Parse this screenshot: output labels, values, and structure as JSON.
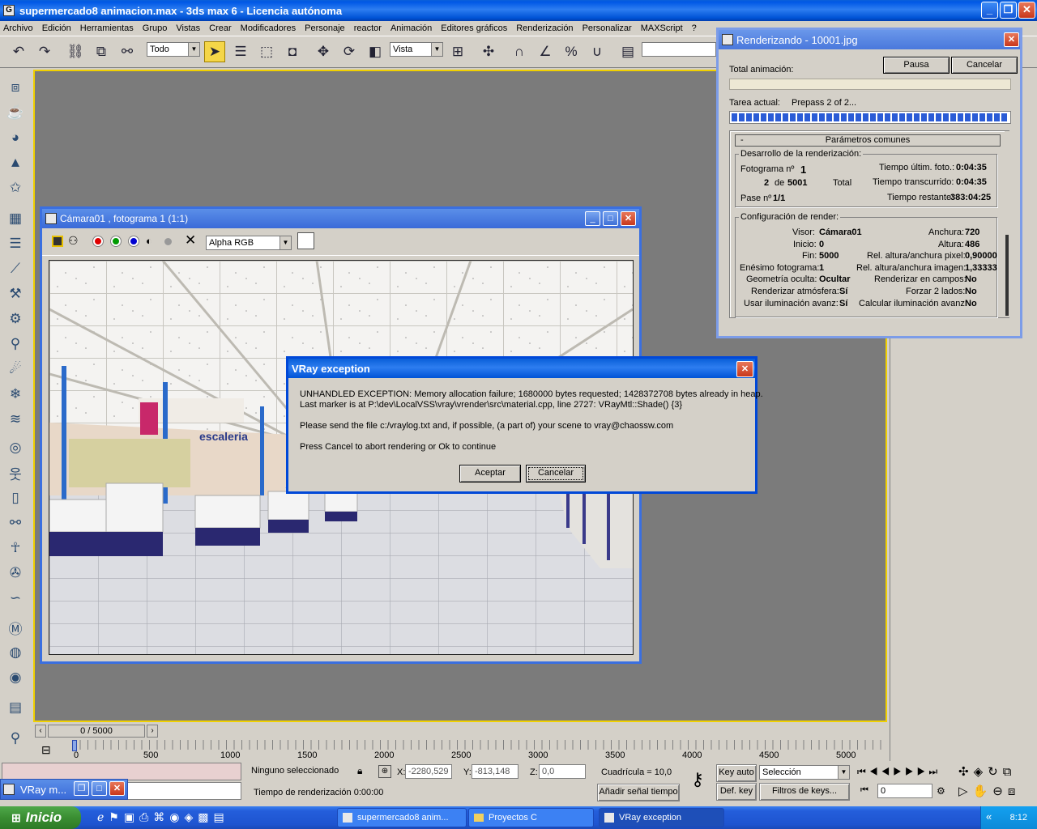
{
  "main_window": {
    "title": "supermercado8 animacion.max - 3ds max 6 - Licencia autónoma",
    "minimize": "_",
    "maximize": "❐",
    "close": "✕"
  },
  "menu": [
    "Archivo",
    "Edición",
    "Herramientas",
    "Grupo",
    "Vistas",
    "Crear",
    "Modificadores",
    "Personaje",
    "reactor",
    "Animación",
    "Editores gráficos",
    "Renderización",
    "Personalizar",
    "MAXScript",
    "?"
  ],
  "toolbar": {
    "selection_filter": "Todo",
    "coord_system": "Vista"
  },
  "frame_window": {
    "title": "Cámara01 , fotograma 1 (1:1)",
    "channel": "Alpha RGB",
    "sign_text": "escaleria",
    "colors": {
      "red": "#e00000",
      "green": "#009a00",
      "blue": "#0000d0"
    }
  },
  "render_dialog": {
    "title": "Renderizando - 10001.jpg",
    "pause": "Pausa",
    "cancel": "Cancelar",
    "total_label": "Total animación:",
    "task_label": "Tarea actual:",
    "task_value": "Prepass 2 of 2...",
    "task_progress": 1.0,
    "section_toggle": "-",
    "section_title": "Parámetros comunes",
    "progress_group": "Desarrollo de la renderización:",
    "frame_label": "Fotograma nº",
    "frame_value": "1",
    "frame_count_a": "2",
    "frame_count_de": "de",
    "frame_count_b": "5001",
    "total_word": "Total",
    "pass_label": "Pase nº",
    "pass_value": "1/1",
    "last_frame_label": "Tiempo últim. foto.:",
    "last_frame_value": "0:04:35",
    "elapsed_label": "Tiempo transcurrido:",
    "elapsed_value": "0:04:35",
    "remaining_label": "Tiempo restante:",
    "remaining_value": "383:04:25",
    "config_group": "Configuración de render:",
    "cfg": {
      "visor_l": "Visor:",
      "visor_v": "Cámara01",
      "inicio_l": "Inicio:",
      "inicio_v": "0",
      "fin_l": "Fin:",
      "fin_v": "5000",
      "nth_l": "Enésimo fotograma:",
      "nth_v": "1",
      "hidden_l": "Geometría oculta:",
      "hidden_v": "Ocultar",
      "atm_l": "Renderizar atmósfera:",
      "atm_v": "Sí",
      "adv_l": "Usar iluminación avanz:",
      "adv_v": "Sí",
      "width_l": "Anchura:",
      "width_v": "720",
      "height_l": "Altura:",
      "height_v": "486",
      "pixel_l": "Rel. altura/anchura pixel:",
      "pixel_v": "0,90000",
      "image_l": "Rel. altura/anchura imagen:",
      "image_v": "1,33333",
      "fields_l": "Renderizar en campos:",
      "fields_v": "No",
      "two_l": "Forzar 2 lados:",
      "two_v": "No",
      "calc_l": "Calcular iluminación avanz:",
      "calc_v": "No"
    }
  },
  "vray_dialog": {
    "title": "VRay exception",
    "line1": "UNHANDLED EXCEPTION: Memory allocation failure; 1680000 bytes requested; 1428372708 bytes already in heap.",
    "line2": "Last marker is at P:\\dev\\LocalVSS\\vray\\vrender\\src\\material.cpp, line 2727: VRayMtl::Shade() {3}",
    "line3": "Please send the file c:/vraylog.txt and, if possible, (a part of) your scene to vray@chaossw.com",
    "line4": "Press Cancel to abort rendering or Ok to continue",
    "ok": "Aceptar",
    "cancel": "Cancelar"
  },
  "timeline": {
    "slider": "0 / 5000",
    "ticks": [
      "0",
      "500",
      "1000",
      "1500",
      "2000",
      "2500",
      "3000",
      "3500",
      "4000",
      "4500",
      "5000"
    ]
  },
  "status": {
    "selection": "Ninguno seleccionado",
    "x_label": "X:",
    "x_value": "-2280,529",
    "y_label": "Y:",
    "y_value": "-813,148",
    "z_label": "Z:",
    "z_value": "0,0",
    "grid": "Cuadrícula = 10,0",
    "render_time": "Tiempo de renderización 0:00:00",
    "add_key": "Añadir señal tiempo",
    "key_auto": "Key auto",
    "def_key": "Def. key",
    "selection_set": "Selección",
    "key_filters": "Filtros de keys...",
    "frame_field": "0"
  },
  "mini_window": {
    "title": "VRay m..."
  },
  "taskbar": {
    "start": "Inicio",
    "tasks": [
      "supermercado8 anim...",
      "Proyectos C",
      "VRay exception"
    ],
    "clock": "8:12"
  }
}
